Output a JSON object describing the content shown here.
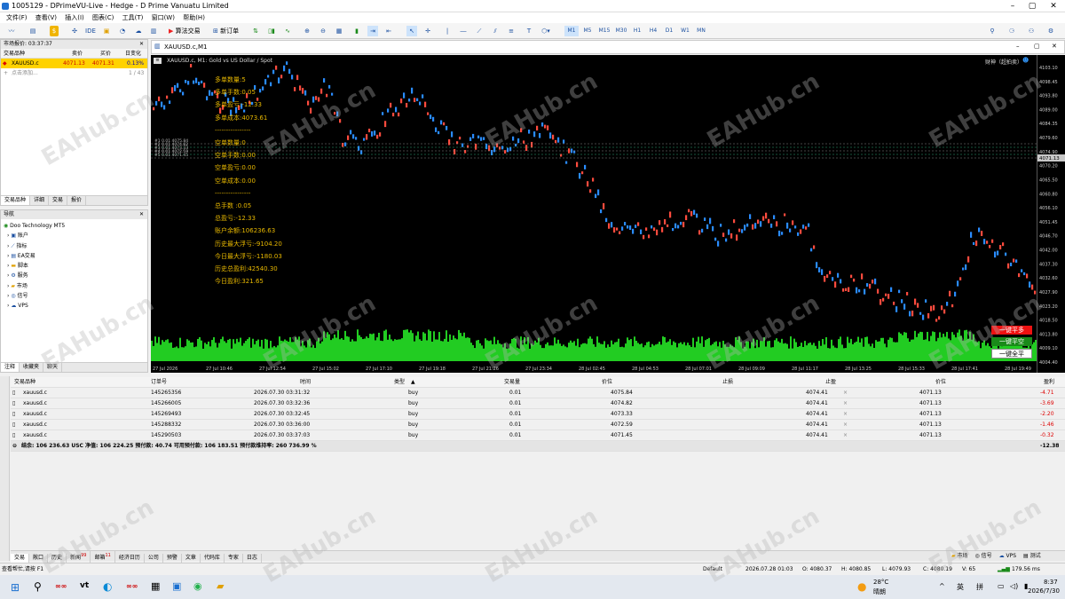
{
  "window": {
    "title": "1005129 - DPrimeVU-Live - Hedge - D Prime Vanuatu Limited"
  },
  "menu": [
    "文件(F)",
    "查看(V)",
    "插入(I)",
    "图表(C)",
    "工具(T)",
    "窗口(W)",
    "帮助(H)"
  ],
  "toolbar": {
    "ide": "IDE",
    "algo": "算法交易",
    "new_order": "新订单",
    "timeframes": [
      "M1",
      "M5",
      "M15",
      "M30",
      "H1",
      "H4",
      "D1",
      "W1",
      "MN"
    ],
    "active_tf": "M1"
  },
  "market_watch": {
    "title": "市场报价: 03:37:37",
    "headers": [
      "交易品种",
      "卖价",
      "买价",
      "日变化"
    ],
    "row": {
      "symbol": "XAUUSD.c",
      "bid": "4071.13",
      "ask": "4071.31",
      "change": "0.13%"
    },
    "add": "点击添加...",
    "count": "1 / 43",
    "tabs": [
      "交易品种",
      "详细",
      "交易",
      "报价"
    ]
  },
  "navigator": {
    "title": "导航",
    "root": "Doo Technology MT5",
    "items": [
      "账户",
      "指标",
      "EA交易",
      "脚本",
      "服务",
      "市场",
      "信号",
      "VPS"
    ],
    "tabs": [
      "注释",
      "收藏夹",
      "聊天"
    ]
  },
  "chart": {
    "tab": "XAUUSD.c,M1",
    "header": "XAUUSD.c, M1:  Gold vs US Dollar / Spot",
    "top_right": "财神（超拍卖）",
    "current_price": "4071.13",
    "price_axis": [
      "4103.10",
      "4098.45",
      "4093.80",
      "4089.00",
      "4084.35",
      "4079.60",
      "4074.90",
      "4070.20",
      "4065.50",
      "4060.80",
      "4056.10",
      "4051.45",
      "4046.70",
      "4042.00",
      "4037.30",
      "4032.60",
      "4027.90",
      "4023.20",
      "4018.50",
      "4013.80",
      "4009.10",
      "4004.40"
    ],
    "time_axis": [
      "27 Jul 2026",
      "27 Jul 10:46",
      "27 Jul 12:54",
      "27 Jul 15:02",
      "27 Jul 17:10",
      "27 Jul 19:18",
      "27 Jul 21:26",
      "27 Jul 23:34",
      "28 Jul 02:45",
      "28 Jul 04:53",
      "28 Jul 07:01",
      "28 Jul 09:09",
      "28 Jul 11:17",
      "28 Jul 13:25",
      "28 Jul 15:33",
      "28 Jul 17:41",
      "28 Jul 19:49"
    ],
    "overlay": [
      "多单数量:5",
      "多单手数:0.05",
      "多单盈亏:-12.33",
      "多单成本:4073.61",
      "----------------",
      "空单数量:0",
      "空单手数:0.00",
      "空单盈亏:0.00",
      "空单成本:0.00",
      "----------------",
      "总手数 :0.05",
      "总盈亏:-12.33",
      "账户余额:106236.63",
      "历史最大浮亏:-9104.20",
      "今日最大浮亏:-1180.03",
      "历史总盈利:42540.30",
      "今日盈利:321.65"
    ],
    "buttons": [
      "一键平多",
      "一键平空",
      "一键全平"
    ],
    "order_lines": [
      "#1 0.01 4075.84",
      "#2 0.01 4074.82",
      "#3 0.01 4073.33",
      "#4 0.01 4072.59",
      "#5 0.01 4071.45"
    ]
  },
  "trade": {
    "headers": [
      "交易品种",
      "订单号",
      "时间",
      "类型",
      "交易量",
      "价位",
      "止损",
      "止盈",
      "价位",
      "盈利"
    ],
    "rows": [
      {
        "symbol": "xauusd.c",
        "ticket": "145265356",
        "time": "2026.07.30 03:31:32",
        "type": "buy",
        "volume": "0.01",
        "price": "4075.84",
        "sl": "",
        "tp": "4074.41",
        "current": "4071.13",
        "profit": "-4.71"
      },
      {
        "symbol": "xauusd.c",
        "ticket": "145266005",
        "time": "2026.07.30 03:32:36",
        "type": "buy",
        "volume": "0.01",
        "price": "4074.82",
        "sl": "",
        "tp": "4074.41",
        "current": "4071.13",
        "profit": "-3.69"
      },
      {
        "symbol": "xauusd.c",
        "ticket": "145269493",
        "time": "2026.07.30 03:32:45",
        "type": "buy",
        "volume": "0.01",
        "price": "4073.33",
        "sl": "",
        "tp": "4074.41",
        "current": "4071.13",
        "profit": "-2.20"
      },
      {
        "symbol": "xauusd.c",
        "ticket": "145288332",
        "time": "2026.07.30 03:36:00",
        "type": "buy",
        "volume": "0.01",
        "price": "4072.59",
        "sl": "",
        "tp": "4074.41",
        "current": "4071.13",
        "profit": "-1.46"
      },
      {
        "symbol": "xauusd.c",
        "ticket": "145290503",
        "time": "2026.07.30 03:37:03",
        "type": "buy",
        "volume": "0.01",
        "price": "4071.45",
        "sl": "",
        "tp": "4074.41",
        "current": "4071.13",
        "profit": "-0.32"
      }
    ],
    "summary": "结余: 106 236.63 USC  净值: 106 224.25  预付款: 40.74  可用预付款: 106 183.51  预付款维持率: 260 736.99 %",
    "summary_profit": "-12.38",
    "tabs": [
      "交易",
      "敞口",
      "历史",
      "新闻",
      "邮箱",
      "经济日历",
      "公司",
      "预警",
      "文章",
      "代码库",
      "专家",
      "日志"
    ],
    "tab_badges": {
      "news": "99",
      "mail": "11"
    },
    "right_tabs": [
      "市场",
      "信号",
      "VPS",
      "测试"
    ]
  },
  "statusbar": {
    "help": "查看帮忙,请按 F1",
    "profile": "Default",
    "datetime": "2026.07.28 01:03",
    "o": "O: 4080.37",
    "h": "H: 4080.85",
    "l": "L: 4079.93",
    "c": "C: 4080.19",
    "v": "V: 65",
    "speed": "179.56 ms"
  },
  "taskbar": {
    "weather_temp": "28°C",
    "weather_desc": "晴朗",
    "lang": "英",
    "ime": "拼",
    "time": "8:37",
    "date": "2026/7/30"
  },
  "watermark": "EAHub.cn",
  "colors": {
    "bull": "#ff4b3e",
    "bear": "#2a8cff",
    "volume": "#22cc22",
    "overlay": "#e8b800",
    "active_row": "#ffd200"
  }
}
